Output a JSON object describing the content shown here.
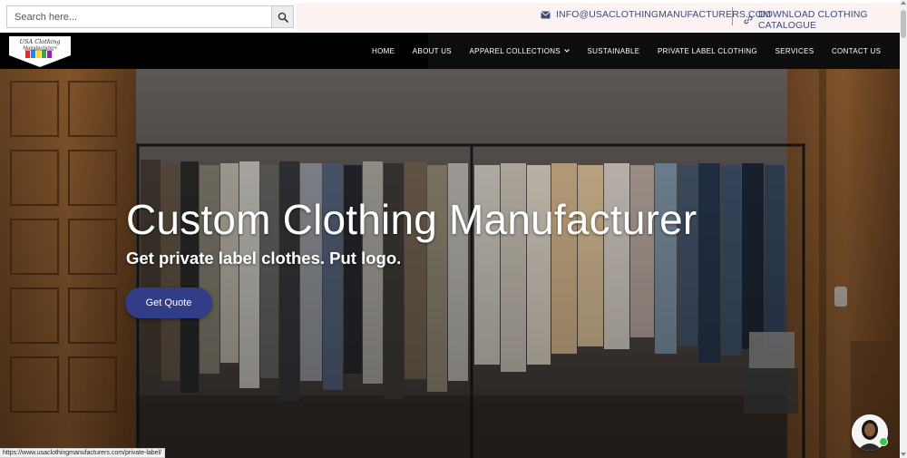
{
  "search": {
    "placeholder": "Search here..."
  },
  "topbar": {
    "email": "INFO@USACLOTHINGMANUFACTURERS.COM",
    "catalogue": "DOWNLOAD CLOTHING CATALOGUE"
  },
  "logo": {
    "line1": "USA Clothing",
    "line2": "Manufacturers"
  },
  "nav": {
    "items": [
      {
        "label": "HOME"
      },
      {
        "label": "ABOUT US"
      },
      {
        "label": "APPAREL COLLECTIONS"
      },
      {
        "label": "SUSTAINABLE"
      },
      {
        "label": "PRIVATE LABEL CLOTHING"
      },
      {
        "label": "SERVICES"
      },
      {
        "label": "CONTACT US"
      }
    ]
  },
  "hero": {
    "title": "Custom Clothing Manufacturer",
    "subtitle": "Get private label clothes. Put logo.",
    "cta": "Get Quote"
  },
  "status_url": "https://www.usaclothingmanufacturers.com/private-label/",
  "colors": {
    "accent": "#313d86",
    "link": "#3f4a7c",
    "nav_bg": "#000000",
    "online": "#3bc353"
  }
}
